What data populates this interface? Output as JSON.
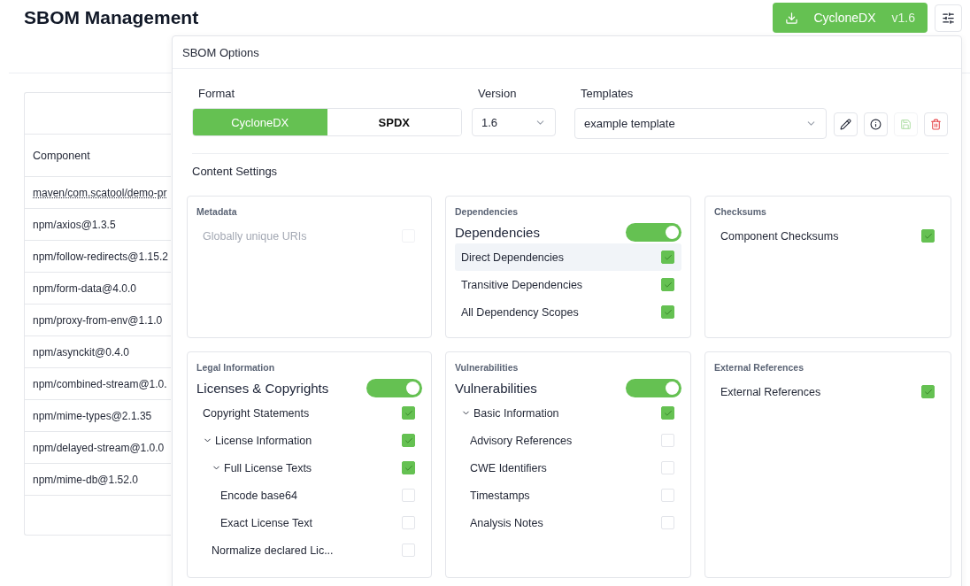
{
  "page": {
    "title": "SBOM Management",
    "export_button": {
      "format": "CycloneDX",
      "version": "v1.6"
    }
  },
  "table": {
    "columns": [
      "Component"
    ],
    "rows": [
      {
        "component": "maven/com.scatool/demo-pr",
        "link": true
      },
      {
        "component": "npm/axios@1.3.5",
        "link": false
      },
      {
        "component": "npm/follow-redirects@1.15.2",
        "link": false
      },
      {
        "component": "npm/form-data@4.0.0",
        "link": false
      },
      {
        "component": "npm/proxy-from-env@1.1.0",
        "link": false
      },
      {
        "component": "npm/asynckit@0.4.0",
        "link": false
      },
      {
        "component": "npm/combined-stream@1.0.",
        "link": false
      },
      {
        "component": "npm/mime-types@2.1.35",
        "link": false
      },
      {
        "component": "npm/delayed-stream@1.0.0",
        "link": false
      },
      {
        "component": "npm/mime-db@1.52.0",
        "link": false
      }
    ]
  },
  "sbom_options": {
    "title": "SBOM Options",
    "format": {
      "label": "Format",
      "options": [
        {
          "label": "CycloneDX",
          "selected": true
        },
        {
          "label": "SPDX",
          "selected": false
        }
      ]
    },
    "version": {
      "label": "Version",
      "value": "1.6"
    },
    "templates": {
      "label": "Templates",
      "value": "example template",
      "actions": [
        {
          "kind": "edit",
          "disabled": false
        },
        {
          "kind": "info",
          "disabled": false
        },
        {
          "kind": "save",
          "disabled": true
        },
        {
          "kind": "delete",
          "disabled": false
        }
      ]
    },
    "content_settings": {
      "title": "Content Settings",
      "sections": [
        {
          "title": "Metadata",
          "items": [
            {
              "label": "Globally unique URIs",
              "checked": false,
              "disabled": true
            }
          ]
        },
        {
          "title": "Dependencies",
          "toggle": {
            "label": "Dependencies",
            "on": true
          },
          "items": [
            {
              "label": "Direct Dependencies",
              "checked": true,
              "highlighted": true
            },
            {
              "label": "Transitive Dependencies",
              "checked": true
            },
            {
              "label": "All Dependency Scopes",
              "checked": true
            }
          ]
        },
        {
          "title": "Checksums",
          "items": [
            {
              "label": "Component Checksums",
              "checked": true
            }
          ]
        },
        {
          "title": "Legal Information",
          "toggle": {
            "label": "Licenses & Copyrights",
            "on": true
          },
          "items": [
            {
              "label": "Copyright Statements",
              "checked": true
            },
            {
              "label": "License Information",
              "checked": true,
              "expanded": true,
              "children": [
                {
                  "label": "Full License Texts",
                  "checked": true,
                  "expanded": true,
                  "children": [
                    {
                      "label": "Encode base64",
                      "checked": false
                    },
                    {
                      "label": "Exact License Text",
                      "checked": false
                    }
                  ]
                },
                {
                  "label": "Normalize declared Lic...",
                  "checked": false
                }
              ]
            }
          ]
        },
        {
          "title": "Vulnerabilities",
          "toggle": {
            "label": "Vulnerabilities",
            "on": true
          },
          "items": [
            {
              "label": "Basic Information",
              "checked": true,
              "expanded": true,
              "children": [
                {
                  "label": "Advisory References",
                  "checked": false
                },
                {
                  "label": "CWE Identifiers",
                  "checked": false
                },
                {
                  "label": "Timestamps",
                  "checked": false
                },
                {
                  "label": "Analysis Notes",
                  "checked": false
                }
              ]
            }
          ]
        },
        {
          "title": "External References",
          "items": [
            {
              "label": "External References",
              "checked": true
            }
          ]
        }
      ]
    }
  }
}
